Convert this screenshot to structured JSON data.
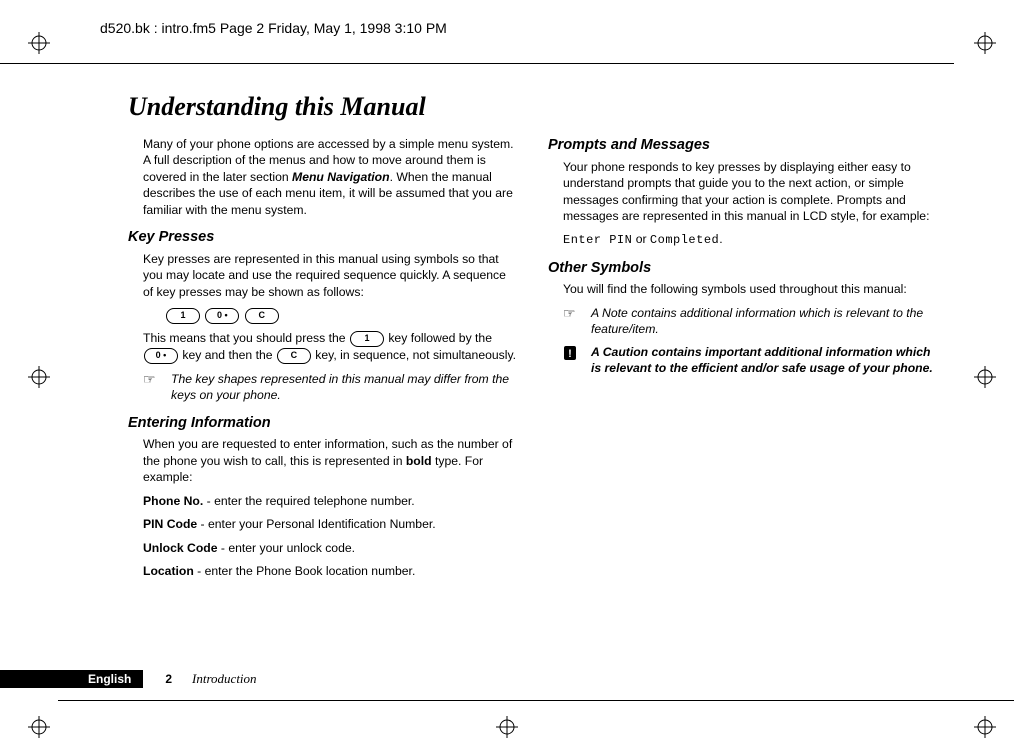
{
  "meta": {
    "header": "d520.bk : intro.fm5  Page 2  Friday, May 1, 1998  3:10 PM"
  },
  "title": "Understanding this Manual",
  "intro": {
    "p1a": "Many of your phone options are accessed by a simple menu system. A full description of the menus and how to move around them is covered in the later section ",
    "p1b": "Menu Navigation",
    "p1c": ". When the manual describes the use of each menu item, it will be assumed that you are familiar with the menu system."
  },
  "keypresses": {
    "heading": "Key Presses",
    "p1": "Key presses are represented in this manual using symbols so that you may locate and use the required sequence quickly. A sequence of key presses may be shown as follows:",
    "k1": "1",
    "k2": "0 •",
    "k3": "C",
    "p2a": "This means that you should press the ",
    "p2b": " key followed by the ",
    "p2c": " key and then the ",
    "p2d": " key, in sequence, not simultaneously.",
    "note": "The key shapes represented in this manual may differ from the keys on your phone."
  },
  "entering": {
    "heading": "Entering Information",
    "p1a": "When you are requested to enter information, such as the number of the phone you wish to call, this is represented in ",
    "p1b": "bold",
    "p1c": " type. For example:",
    "i1a": "Phone No.",
    "i1b": " - enter the required telephone number.",
    "i2a": "PIN Code",
    "i2b": " - enter your Personal Identification Number.",
    "i3a": "Unlock Code",
    "i3b": " - enter your unlock code.",
    "i4a": "Location",
    "i4b": " - enter the Phone Book location number."
  },
  "prompts": {
    "heading": "Prompts and Messages",
    "p1": "Your phone responds to key presses by displaying either easy to understand prompts that guide you to the next action, or simple messages confirming that your action is complete. Prompts and messages are represented in this manual in LCD style, for example:",
    "lcd1": "Enter PIN",
    "mid": " or ",
    "lcd2": "Completed",
    "end": "."
  },
  "other": {
    "heading": "Other Symbols",
    "p1": "You will find the following symbols used throughout this manual:",
    "note": "A Note contains additional information which is relevant to the feature/item.",
    "caution": "A Caution contains important additional information which is relevant to the efficient and/or safe usage of your phone."
  },
  "icons": {
    "note": "☞",
    "caution": "!"
  },
  "footer": {
    "lang": "English",
    "pagenum": "2",
    "section": "Introduction"
  }
}
